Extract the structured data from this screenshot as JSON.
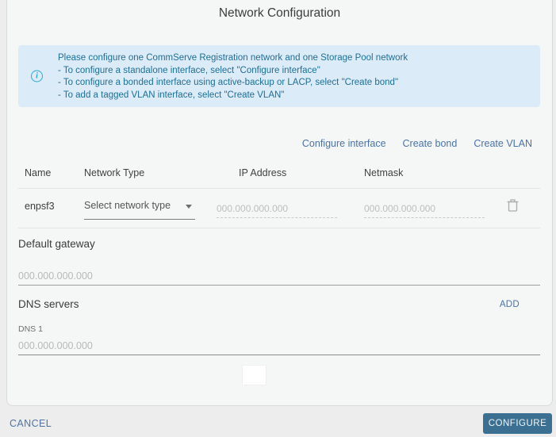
{
  "dialog": {
    "title": "Network Configuration"
  },
  "info_banner": {
    "icon": "info-icon",
    "icon_glyph": "i",
    "lines": [
      "Please configure one CommServe Registration network and one Storage Pool network",
      "- To configure a standalone interface, select \"Configure interface\"",
      "- To configure a bonded interface using active-backup or LACP, select \"Create bond\"",
      "- To add a tagged VLAN interface, select \"Create VLAN\""
    ]
  },
  "actions": {
    "configure_interface": "Configure interface",
    "create_bond": "Create bond",
    "create_vlan": "Create VLAN"
  },
  "interfaces_table": {
    "headers": [
      "Name",
      "Network Type",
      "IP Address",
      "Netmask"
    ],
    "rows": [
      {
        "name": "enpsf3",
        "network_type_selected": "Select network type",
        "ip_value": "",
        "ip_placeholder": "000.000.000.000",
        "netmask_value": "",
        "netmask_placeholder": "000.000.000.000",
        "delete_icon": "trash-icon"
      }
    ]
  },
  "default_gateway": {
    "label": "Default gateway",
    "value": "",
    "placeholder": "000.000.000.000"
  },
  "dns": {
    "label": "DNS servers",
    "add_label": "ADD",
    "entries": [
      {
        "label": "DNS 1",
        "value": "",
        "placeholder": "000.000.000.000"
      }
    ]
  },
  "footer": {
    "cancel_label": "CANCEL",
    "configure_label": "CONFIGURE"
  },
  "colors": {
    "card_bg": "#f5f6f6",
    "page_bg": "#ededee",
    "info_banner_bg": "#dbecf8",
    "info_text": "#1e6d96",
    "info_icon": "#29a8dd",
    "link_blue": "#4a74a8",
    "configure_button_bg": "#3b7092",
    "placeholder_gray": "#bdbebe"
  }
}
